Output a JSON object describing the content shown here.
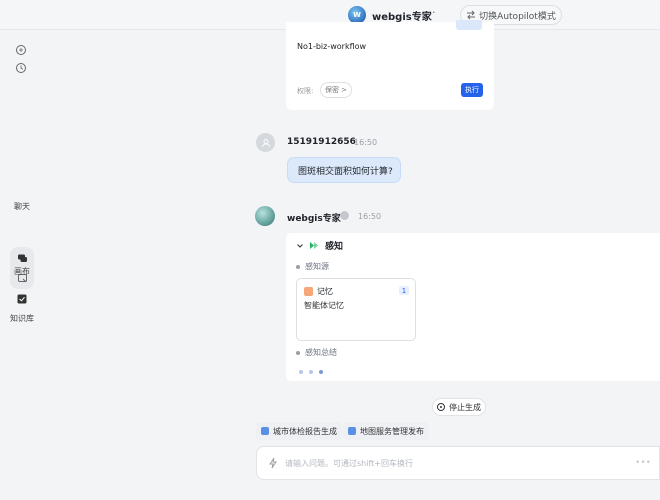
{
  "header": {
    "bot_avatar_letter": "W",
    "bot_name": "webgis专家",
    "more_label": "···",
    "autopilot_label": "切换Autopilot模式"
  },
  "sidebar": {
    "chat_label": "聊天",
    "canvas_label": "画布",
    "kb_label": "知识库"
  },
  "workflow_card": {
    "name": "No1-biz-workflow",
    "perm_label": "权限:",
    "perm_value": "保密 >",
    "exec_label": "执行"
  },
  "user_message": {
    "name": "15191912656",
    "time": "16:50",
    "text": "图斑相交面积如何计算?"
  },
  "agent_message": {
    "name": "webgis专家",
    "time": "16:50",
    "section_title": "感知",
    "source_label": "感知源",
    "memory": {
      "title": "记忆",
      "count": "1",
      "desc": "智能体记忆"
    },
    "summary_label": "感知总结"
  },
  "stop_label": "停止生成",
  "shortcuts": [
    "城市体检报告生成",
    "地图服务管理发布"
  ],
  "composer": {
    "placeholder": "请输入问题。可通过shift+回车换行",
    "send_label": "•••"
  }
}
